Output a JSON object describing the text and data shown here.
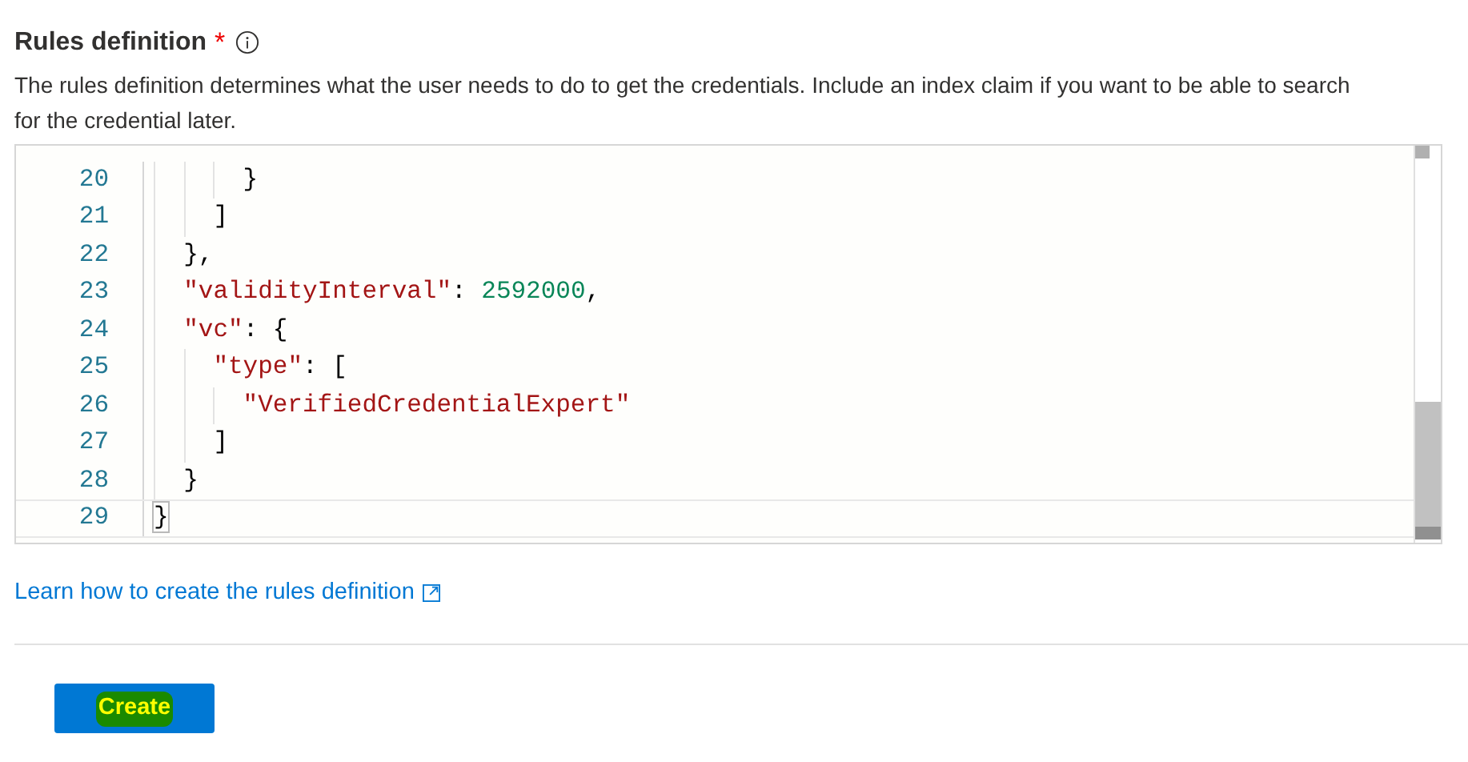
{
  "field": {
    "label": "Rules definition",
    "required_mark": "*",
    "description": "The rules definition determines what the user needs to do to get the credentials. Include an index claim if you want to be able to search for the credential later."
  },
  "editor": {
    "lines": [
      {
        "children": [
          {
            "children": [
              {
                "children": [
                  {
                    "number": "20",
                    "selected": false,
                    "tokens": [
                      {
                        "kind": "punct",
                        "text": "}"
                      }
                    ]
                  }
                ]
              },
              {
                "number": "21",
                "selected": false,
                "tokens": [
                  {
                    "kind": "punct",
                    "text": "]"
                  }
                ]
              }
            ]
          },
          {
            "number": "22",
            "selected": false,
            "tokens": [
              {
                "kind": "punct",
                "text": "},"
              }
            ]
          },
          {
            "number": "23",
            "selected": false,
            "tokens": [
              {
                "kind": "key",
                "text": "\"validityInterval\""
              },
              {
                "kind": "punct",
                "text": ": "
              },
              {
                "kind": "number",
                "text": "2592000"
              },
              {
                "kind": "punct",
                "text": ","
              }
            ]
          },
          {
            "number": "24",
            "selected": false,
            "tokens": [
              {
                "kind": "key",
                "text": "\"vc\""
              },
              {
                "kind": "punct",
                "text": ": {"
              }
            ]
          },
          {
            "children": [
              {
                "number": "25",
                "selected": false,
                "tokens": [
                  {
                    "kind": "key",
                    "text": "\"type\""
                  },
                  {
                    "kind": "punct",
                    "text": ": ["
                  }
                ]
              },
              {
                "children": [
                  {
                    "number": "26",
                    "selected": false,
                    "tokens": [
                      {
                        "kind": "string",
                        "text": "\"VerifiedCredentialExpert\""
                      }
                    ]
                  }
                ]
              },
              {
                "number": "27",
                "selected": false,
                "tokens": [
                  {
                    "kind": "punct",
                    "text": "]"
                  }
                ]
              }
            ]
          },
          {
            "number": "28",
            "selected": false,
            "tokens": [
              {
                "kind": "punct",
                "text": "}"
              }
            ]
          }
        ]
      },
      {
        "number": "29",
        "selected": true,
        "tokens": [
          {
            "kind": "bracket",
            "text": "}"
          }
        ]
      }
    ]
  },
  "link": {
    "text": "Learn how to create the rules definition"
  },
  "buttons": [
    {
      "label": "Create",
      "highlighted": true
    }
  ]
}
